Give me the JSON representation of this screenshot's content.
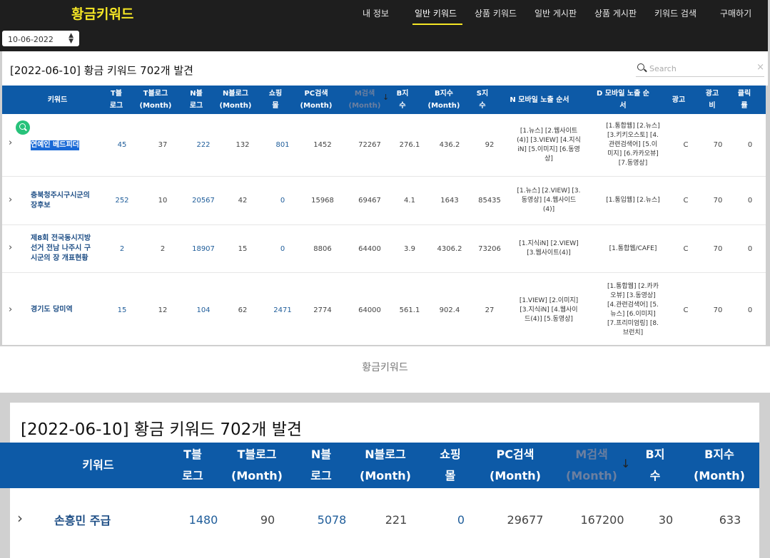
{
  "brand": "황금키워드",
  "nav": {
    "items": [
      "내 정보",
      "일반 키워드",
      "상품 키워드",
      "일반 게시판",
      "상품 게시판",
      "키워드 검색",
      "구매하기"
    ],
    "active_index": 1
  },
  "date_select": {
    "value": "10-06-2022"
  },
  "panel": {
    "title": "[2022-06-10] 황금 키워드 702개 발견"
  },
  "search": {
    "placeholder": "Search",
    "clear": "×"
  },
  "headers": [
    "키워드",
    "T블\n로그",
    "T블로그\n(Month)",
    "N블\n로그",
    "N블로그\n(Month)",
    "쇼핑\n몰",
    "PC검색\n(Month)",
    "M검색\n(Month)",
    "B지\n수",
    "B지수\n(Month)",
    "S지\n수",
    "N 모바일 노출 순서",
    "D 모바일 노출 순\n서",
    "광고",
    "광고\n비",
    "클릭\n률"
  ],
  "sort_arrow": "↓",
  "rows": [
    {
      "keyword": "연예인 베드피더",
      "t_blog": "45",
      "t_blog_month": "37",
      "n_blog": "222",
      "n_blog_month": "132",
      "shopping": "801",
      "pc_search": "1452",
      "m_search": "72267",
      "b_index": "276.1",
      "b_index_month": "436.2",
      "s_index": "92",
      "n_mobile": "[1.뉴스] [2.웹사이트\n(4)] [3.VIEW] [4.지식\niN] [5.이미지] [6.동영\n상]",
      "d_mobile": "[1.통합웹] [2.뉴스]\n[3.키키오스토] [4.\n관련검색어] [5.이\n미지] [6.카카오뷰]\n[7.동영상]",
      "ad": "C",
      "ad_cost": "70",
      "ctr": "0"
    },
    {
      "keyword": "충북청주시구시군의\n장후보",
      "t_blog": "252",
      "t_blog_month": "10",
      "n_blog": "20567",
      "n_blog_month": "42",
      "shopping": "0",
      "pc_search": "15968",
      "m_search": "69467",
      "b_index": "4.1",
      "b_index_month": "1643",
      "s_index": "85435",
      "n_mobile": "[1.뉴스] [2.VIEW] [3.\n동영상] [4.웹사이드\n(4)]",
      "d_mobile": "[1.통입웹] [2.뉴스]",
      "ad": "C",
      "ad_cost": "70",
      "ctr": "0"
    },
    {
      "keyword": "제8회 전국동시지방\n선거 전남 나주시 구\n시군의 장 개표현황",
      "t_blog": "2",
      "t_blog_month": "2",
      "n_blog": "18907",
      "n_blog_month": "15",
      "shopping": "0",
      "pc_search": "8806",
      "m_search": "64400",
      "b_index": "3.9",
      "b_index_month": "4306.2",
      "s_index": "73206",
      "n_mobile": "[1.지식iN] [2.VIEW]\n[3.웹사이트(4)]",
      "d_mobile": "[1.통합웹/CAFE]",
      "ad": "C",
      "ad_cost": "70",
      "ctr": "0"
    },
    {
      "keyword": "경기도 당미역",
      "t_blog": "15",
      "t_blog_month": "12",
      "n_blog": "104",
      "n_blog_month": "62",
      "shopping": "2471",
      "pc_search": "2774",
      "m_search": "64000",
      "b_index": "561.1",
      "b_index_month": "902.4",
      "s_index": "27",
      "n_mobile": "[1.VIEW] [2.이미지]\n[3.지식iN] [4.웹사이\n드(4)] [5.동영상]",
      "d_mobile": "[1.통합웹] [2.카카\n오뷰] [3.동영상]\n[4.관련검색어] [5.\n뉴스] [6.이미지]\n[7.프리미엄링] [8.\n브런치]",
      "ad": "C",
      "ad_cost": "70",
      "ctr": "0"
    }
  ],
  "caption": "황금키워드",
  "zoom": {
    "title": "[2022-06-10] 황금 키워드 702개 발견",
    "headers": [
      "키워드",
      "T블\n로그",
      "T블로그\n(Month)",
      "N블\n로그",
      "N블로그\n(Month)",
      "쇼핑\n몰",
      "PC검색\n(Month)",
      "M검색\n(Month)",
      "B지\n수",
      "B지수\n(Month)"
    ],
    "row": {
      "keyword": "손흥민 주급",
      "t_blog": "1480",
      "t_blog_month": "90",
      "n_blog": "5078",
      "n_blog_month": "221",
      "shopping": "0",
      "pc_search": "29677",
      "m_search": "167200",
      "b_index": "30",
      "b_index_month": "633"
    }
  },
  "icons": {
    "expand": "chevron-right-icon",
    "search": "search-icon",
    "lens": "magnifier-badge-icon"
  }
}
